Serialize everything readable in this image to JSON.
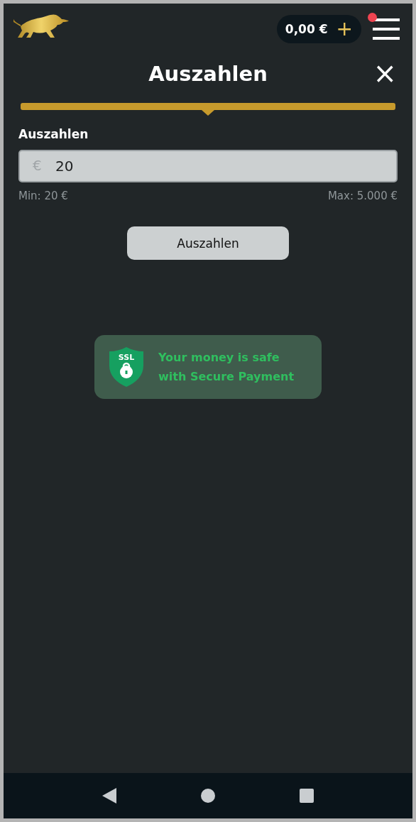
{
  "header": {
    "balance": "0,00 €",
    "add_symbol": "+",
    "has_notification": true
  },
  "dialog": {
    "title": "Auszahlen",
    "close_symbol": "×",
    "amount": {
      "label": "Auszahlen",
      "currency": "€",
      "value": "20",
      "min": "Min: 20 €",
      "max": "Max: 5.000 €"
    },
    "submit": "Auszahlen",
    "security": {
      "badge": "SSL",
      "text": "Your money is safe with Secure Payment"
    }
  },
  "nav_bar": {
    "buttons": [
      {
        "kind": "back"
      },
      {
        "kind": "home"
      },
      {
        "kind": "recents"
      }
    ]
  }
}
